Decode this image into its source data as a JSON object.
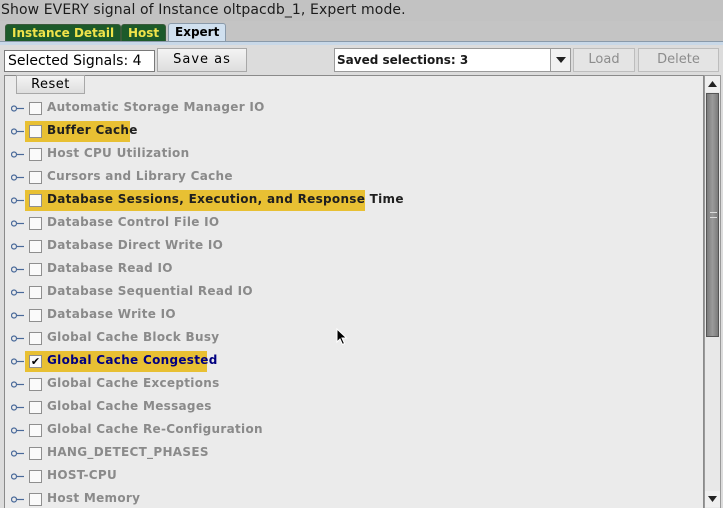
{
  "window": {
    "title": "Show EVERY signal of Instance oltpacdb_1, Expert mode."
  },
  "tabs": [
    {
      "label": "Instance Detail",
      "active": false
    },
    {
      "label": "Host",
      "active": false
    },
    {
      "label": "Expert",
      "active": true
    }
  ],
  "toolbar": {
    "selected_signals_label": "Selected Signals: 4",
    "save_as_label": "Save  as",
    "saved_selections_value": "Saved selections: 3",
    "load_label": "Load",
    "delete_label": "Delete",
    "reset_label": "Reset"
  },
  "colors": {
    "highlight": "#e8c033",
    "tab_dark": "#1d5a2a",
    "tab_text": "#f0e34a",
    "checked_text": "#000080"
  },
  "signals": [
    {
      "label": "Automatic Storage Manager IO",
      "highlighted": false,
      "checked": false
    },
    {
      "label": "Buffer Cache",
      "highlighted": true,
      "checked": false
    },
    {
      "label": "Host CPU Utilization",
      "highlighted": false,
      "checked": false
    },
    {
      "label": "Cursors and Library Cache",
      "highlighted": false,
      "checked": false
    },
    {
      "label": "Database Sessions, Execution, and Response Time",
      "highlighted": true,
      "checked": false
    },
    {
      "label": "Database Control File IO",
      "highlighted": false,
      "checked": false
    },
    {
      "label": "Database Direct Write IO",
      "highlighted": false,
      "checked": false
    },
    {
      "label": "Database Read IO",
      "highlighted": false,
      "checked": false
    },
    {
      "label": "Database Sequential Read IO",
      "highlighted": false,
      "checked": false
    },
    {
      "label": "Database Write IO",
      "highlighted": false,
      "checked": false
    },
    {
      "label": "Global Cache Block Busy",
      "highlighted": false,
      "checked": false
    },
    {
      "label": "Global Cache Congested",
      "highlighted": true,
      "checked": true
    },
    {
      "label": "Global Cache Exceptions",
      "highlighted": false,
      "checked": false
    },
    {
      "label": "Global Cache Messages",
      "highlighted": false,
      "checked": false
    },
    {
      "label": "Global Cache Re-Configuration",
      "highlighted": false,
      "checked": false
    },
    {
      "label": "HANG_DETECT_PHASES",
      "highlighted": false,
      "checked": false
    },
    {
      "label": "HOST-CPU",
      "highlighted": false,
      "checked": false
    },
    {
      "label": "Host Memory",
      "highlighted": false,
      "checked": false
    }
  ],
  "scrollbar": {
    "position": 0.0,
    "visible_fraction": 0.6
  }
}
